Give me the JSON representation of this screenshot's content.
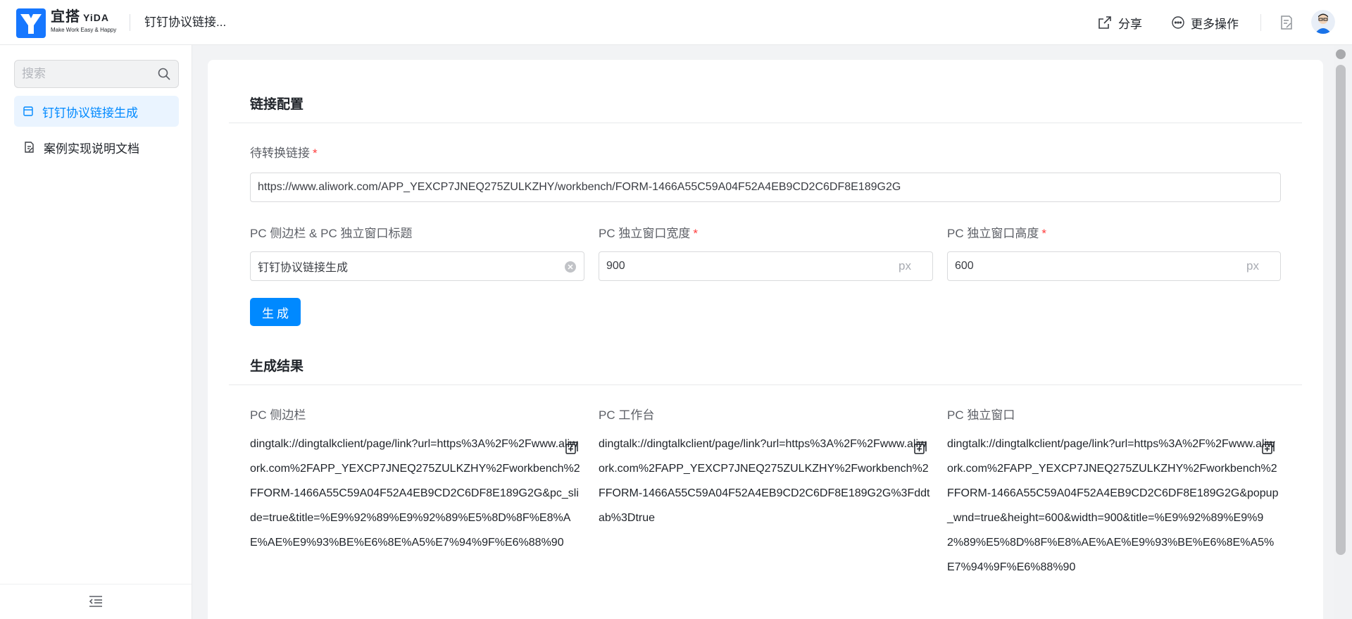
{
  "header": {
    "brand_name": "宜搭",
    "brand_en": "YiDA",
    "brand_slogan": "Make Work Easy & Happy",
    "app_title": "钉钉协议链接...",
    "share_label": "分享",
    "more_label": "更多操作"
  },
  "sidebar": {
    "search_placeholder": "搜索",
    "items": [
      {
        "label": "钉钉协议链接生成",
        "active": true
      },
      {
        "label": "案例实现说明文档",
        "active": false
      }
    ]
  },
  "config": {
    "section_title": "链接配置",
    "source_link_label": "待转换链接",
    "source_link_value": "https://www.aliwork.com/APP_YEXCP7JNEQ275ZULKZHY/workbench/FORM-1466A55C59A04F52A4EB9CD2C6DF8E189G2G",
    "title_label": "PC 侧边栏 & PC 独立窗口标题",
    "title_value": "钉钉协议链接生成",
    "width_label": "PC 独立窗口宽度",
    "width_value": "900",
    "height_label": "PC 独立窗口高度",
    "height_value": "600",
    "unit": "px",
    "required_mark": "*",
    "generate_label": "生成"
  },
  "result": {
    "section_title": "生成结果",
    "columns": [
      {
        "label": "PC 侧边栏",
        "value": "dingtalk://dingtalkclient/page/link?url=https%3A%2F%2Fwww.aliwork.com%2FAPP_YEXCP7JNEQ275ZULKZHY%2Fworkbench%2FFORM-1466A55C59A04F52A4EB9CD2C6DF8E189G2G&pc_slide=true&title=%E9%92%89%E9%92%89%E5%8D%8F%E8%AE%AE%E9%93%BE%E6%8E%A5%E7%94%9F%E6%88%90"
      },
      {
        "label": "PC 工作台",
        "value": "dingtalk://dingtalkclient/page/link?url=https%3A%2F%2Fwww.aliwork.com%2FAPP_YEXCP7JNEQ275ZULKZHY%2Fworkbench%2FFORM-1466A55C59A04F52A4EB9CD2C6DF8E189G2G%3Fddtab%3Dtrue"
      },
      {
        "label": "PC 独立窗口",
        "value": "dingtalk://dingtalkclient/page/link?url=https%3A%2F%2Fwww.aliwork.com%2FAPP_YEXCP7JNEQ275ZULKZHY%2Fworkbench%2FFORM-1466A55C59A04F52A4EB9CD2C6DF8E189G2G&popup_wnd=true&height=600&width=900&title=%E9%92%89%E9%92%89%E5%8D%8F%E8%AE%AE%E9%93%BE%E6%8E%A5%E7%94%9F%E6%88%90"
      }
    ]
  },
  "colors": {
    "accent": "#0089ff",
    "required": "#ff3d3d"
  },
  "icons": [
    "yida-logo-icon",
    "share-icon",
    "more-icon",
    "doc-icon",
    "search-icon",
    "form-icon",
    "doc-edit-icon",
    "collapse-icon",
    "clear-icon",
    "copy-icon"
  ]
}
